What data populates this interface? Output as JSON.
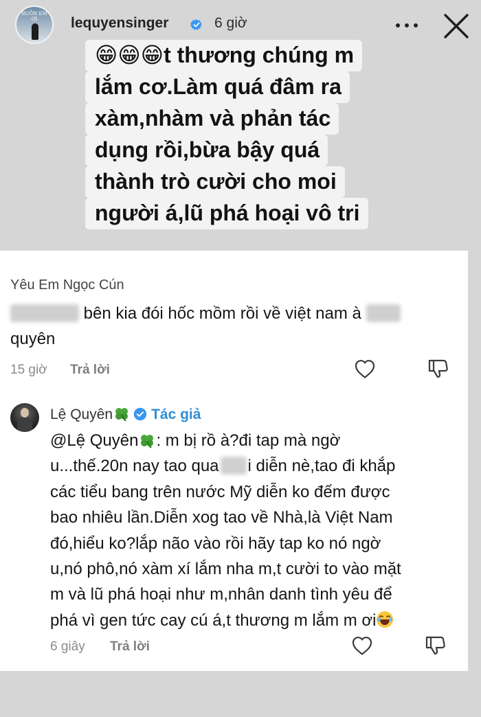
{
  "header": {
    "username": "lequyensinger",
    "time": "6 giờ",
    "avatar_text": "BUỒN EM ƠI"
  },
  "caption": {
    "lines": [
      "😁😁😁t thương chúng m",
      "lắm cơ.Làm quá đâm ra",
      "xàm,nhàm và phản tác",
      "dụng rồi,bừa bậy quá",
      "thành trò cười cho moi",
      "người á,lũ phá hoại vô tri"
    ]
  },
  "comments": [
    {
      "author": "Yêu Em Ngọc Cún",
      "text_part1": "bên kia đói hốc mồm rồi về việt nam à",
      "text_part2": "quyên",
      "time": "15 giờ",
      "reply_label": "Trả lời"
    },
    {
      "author": "Lệ Quyên",
      "author_tag": "Tác giả",
      "mention": "@Lệ Quyên",
      "line1_rest": ": m bị rồ à?đi tap mà ngờ",
      "line2_a": "u...thế.20n nay tao qua",
      "line2_b": "i diễn nè,tao đi khắp",
      "lines": [
        "các tiểu bang trên nước Mỹ diễn ko đếm được",
        "bao nhiêu lần.Diễn xog tao về Nhà,là Việt Nam",
        "đó,hiểu ko?lắp não vào rồi hãy tap ko nó ngờ",
        "u,nó phô,nó xàm xí lắm nha m,t cười to vào mặt",
        "m và lũ phá hoại như m,nhân danh tình yêu để"
      ],
      "last_line": "phá vì gen tức cay cú á,t thương m lắm m ơi",
      "time": "6 giây",
      "reply_label": "Trả lời"
    }
  ],
  "colors": {
    "background": "#d6d6d6",
    "caption_bg": "#f3f3f3",
    "author_tag": "#2f8fd6",
    "verified": "#3897f0"
  },
  "icons": [
    "verified-badge-icon",
    "more-options-icon",
    "close-icon",
    "heart-icon",
    "dislike-icon",
    "clover-icon",
    "laugh-emoji-icon"
  ]
}
